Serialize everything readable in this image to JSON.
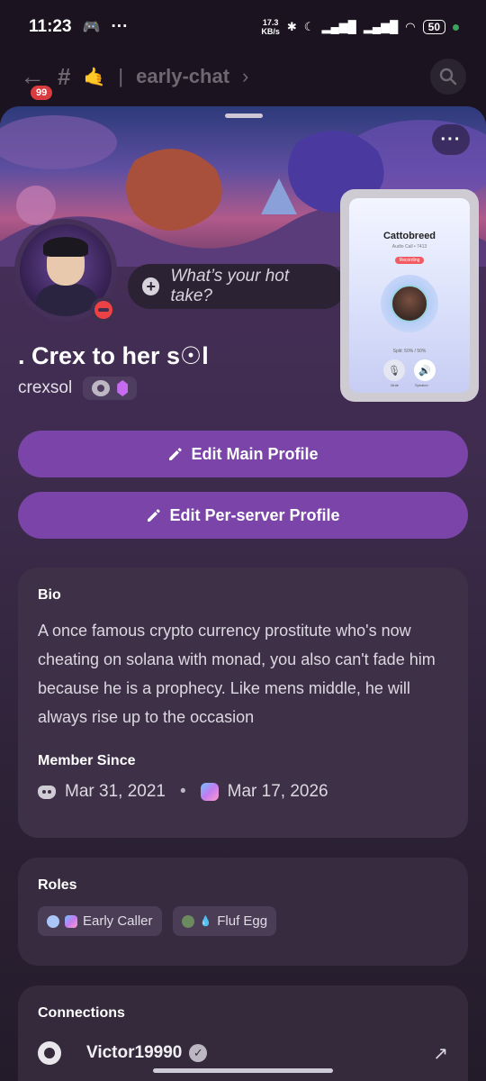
{
  "status_bar": {
    "time": "11:23",
    "more": "···",
    "speed_value": "17.3",
    "speed_unit": "KB/s",
    "battery": "50"
  },
  "channel_bar": {
    "unread_badge": "99",
    "channel_name": "early-chat",
    "chevron": "›"
  },
  "profile": {
    "more_label": "···",
    "hot_take_placeholder": "What’s your hot take?",
    "display_name": ". Crex to her s☉l",
    "username": "crexsol",
    "status": "do-not-disturb"
  },
  "call_pip": {
    "name": "Cattobreed",
    "subtitle": "Audio Call • 7413",
    "recording": "Recording",
    "split": "Split: 50% / 50%",
    "controls": [
      "Mute",
      "Speaker"
    ]
  },
  "actions": {
    "edit_main": "Edit Main Profile",
    "edit_server": "Edit Per-server Profile"
  },
  "bio": {
    "title": "Bio",
    "text": "A once famous crypto currency prostitute who's now cheating on solana with monad, you also can't fade him because he is a prophecy. Like mens middle, he will always rise up to the occasion",
    "member_since_title": "Member Since",
    "discord_date": "Mar 31, 2021",
    "separator": "•",
    "server_date": "Mar 17, 2026"
  },
  "roles": {
    "title": "Roles",
    "items": [
      {
        "label": "Early Caller",
        "color": "#a9c6f7"
      },
      {
        "label": "Fluf Egg",
        "color": "#6c8a5f"
      }
    ]
  },
  "connections": {
    "title": "Connections",
    "items": [
      {
        "name": "Victor19990",
        "service": "github-icon"
      }
    ]
  },
  "colors": {
    "accent_button": "#7a44a8",
    "dnd": "#ed4245",
    "online": "#3ba55d"
  }
}
